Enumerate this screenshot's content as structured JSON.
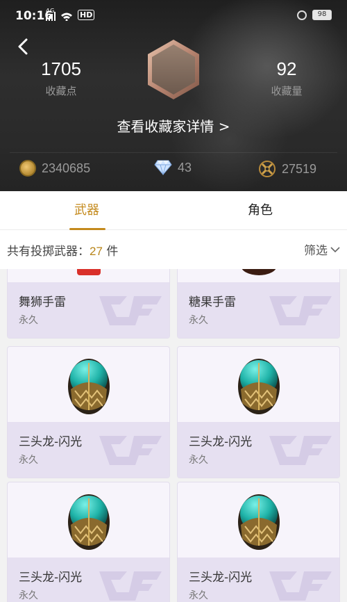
{
  "status_bar": {
    "time": "10:16",
    "network": "4G",
    "battery": "98"
  },
  "header": {
    "collection_points": {
      "value": "1705",
      "label": "收藏点"
    },
    "collection_count": {
      "value": "92",
      "label": "收藏量"
    },
    "collector_link": "查看收藏家详情 >",
    "resources": [
      {
        "icon": "gold-coin-icon",
        "value": "2340685"
      },
      {
        "icon": "diamond-icon",
        "value": "43"
      },
      {
        "icon": "crossed-weapons-icon",
        "value": "27519"
      }
    ]
  },
  "tabs": [
    {
      "label": "武器",
      "active": true
    },
    {
      "label": "角色",
      "active": false
    }
  ],
  "filter": {
    "count_prefix": "共有投掷武器：",
    "count_value": "27",
    "count_suffix": " 件",
    "filter_label": "筛选"
  },
  "items": [
    {
      "name": "舞狮手雷",
      "term": "永久"
    },
    {
      "name": "糖果手雷",
      "term": "永久"
    },
    {
      "name": "三头龙-闪光",
      "term": "永久"
    },
    {
      "name": "三头龙-闪光",
      "term": "永久"
    },
    {
      "name": "三头龙-闪光",
      "term": "永久"
    },
    {
      "name": "三头龙-闪光",
      "term": "永久"
    }
  ],
  "colors": {
    "accent": "#c48a1d",
    "card_bg": "#f7f4fb",
    "card_info_bg": "#e6e0f1",
    "egg_teal": "#1fb3a8",
    "egg_gold": "#b08a3a"
  }
}
